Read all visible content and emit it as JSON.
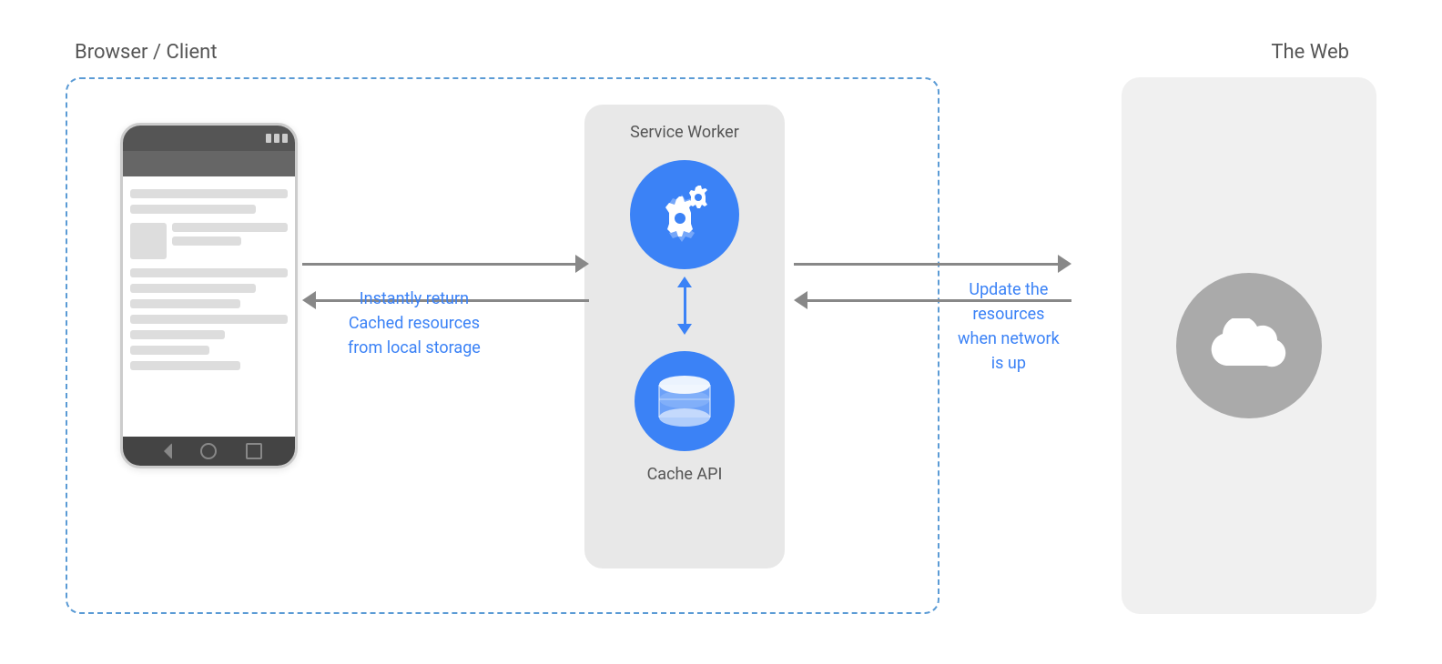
{
  "labels": {
    "browser_client": "Browser / Client",
    "the_web": "The Web",
    "service_worker": "Service Worker",
    "cache_api": "Cache API",
    "instantly_return": "Instantly return",
    "cached_resources": "Cached resources",
    "from_local_storage": "from local storage",
    "update_the": "Update the",
    "resources": "resources",
    "when_network": "when network",
    "is_up": "is up"
  },
  "colors": {
    "blue": "#3b82f6",
    "dashed_border": "#5b9bd5",
    "text_gray": "#555",
    "arrow_gray": "#888",
    "panel_bg": "#e8e8e8",
    "web_box_bg": "#f0f0f0",
    "cloud_bg": "#aaa"
  }
}
